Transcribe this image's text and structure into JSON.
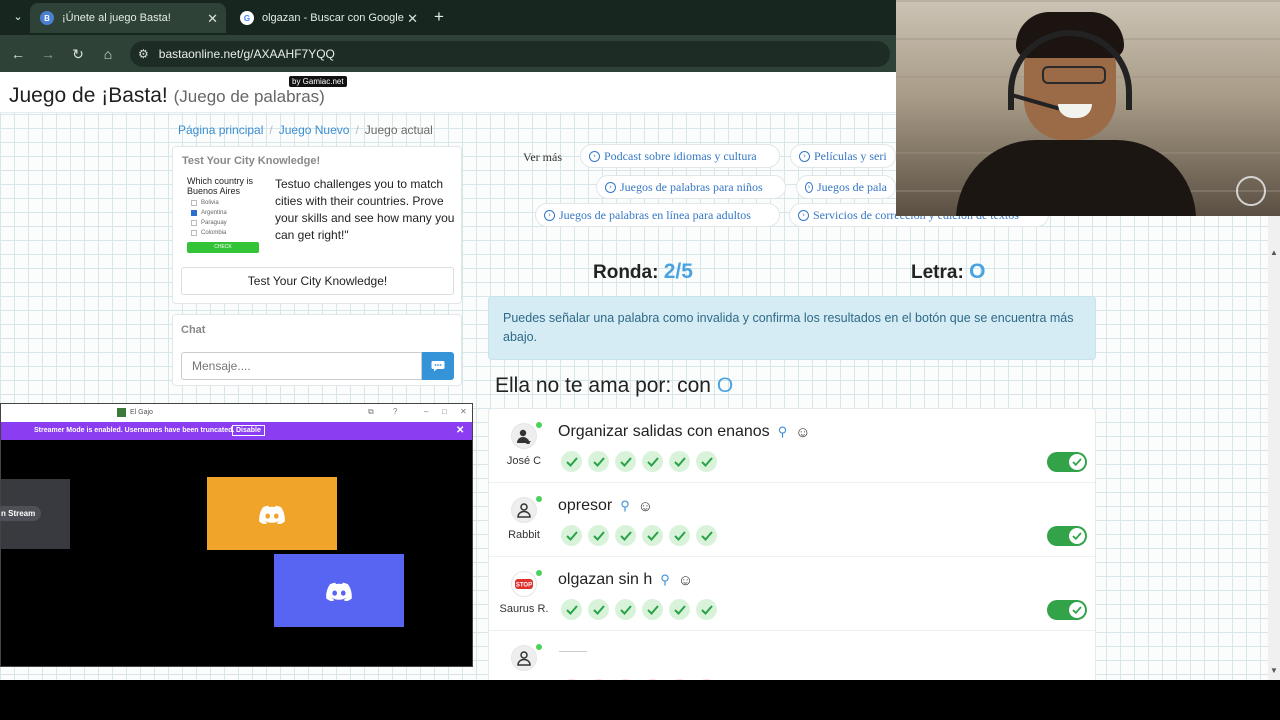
{
  "browser": {
    "tabs": [
      {
        "title": "¡Únete al juego Basta!",
        "active": true
      },
      {
        "title": "olgazan - Buscar con Google",
        "active": false
      }
    ],
    "url": "bastaonline.net/g/AXAAHF7YQQ"
  },
  "site": {
    "title": "Juego de ¡Basta!",
    "subtitle": "(Juego de palabras)",
    "badge": "by Gamiac.net"
  },
  "breadcrumb": {
    "home": "Página principal",
    "new_game": "Juego Nuevo",
    "current": "Juego actual"
  },
  "ad": {
    "heading": "Test Your City Knowledge!",
    "mini_question": "Which country is Buenos Aires",
    "mini_options": [
      "Bolivia",
      "Argentina",
      "Paraguay",
      "Colombia"
    ],
    "mini_checked": "Argentina",
    "mini_button": "CHECK",
    "text": "Testuo challenges you to match cities with their countries. Prove your skills and see how many you can get right!\"",
    "button": "Test Your City Knowledge!"
  },
  "chat": {
    "heading": "Chat",
    "placeholder": "Mensaje...."
  },
  "links": {
    "label": "Ver más",
    "items": [
      "Podcast sobre idiomas y cultura",
      "Películas y seri",
      "Juegos de palabras para niños",
      "Juegos de pala",
      "Juegos de palabras en línea para adultos",
      "Servicios de corrección y edición de textos"
    ]
  },
  "game": {
    "round_label": "Ronda:",
    "round_value": "2/5",
    "letter_label": "Letra:",
    "letter_value": "O",
    "info": "Puedes señalar una palabra como invalida y confirma los resultados en el botón que se encuentra más abajo.",
    "category_text": "Ella no te ama por: con",
    "category_letter": "O"
  },
  "answers": [
    {
      "user": "José C",
      "word": "Organizar salidas con enanos",
      "votes_ok": 6,
      "valid": true
    },
    {
      "user": "Rabbit",
      "word": "opresor",
      "votes_ok": 6,
      "valid": true
    },
    {
      "user": "Saurus R.",
      "word": "olgazan sin h",
      "votes_ok": 6,
      "valid": true
    },
    {
      "user": "",
      "word": "",
      "votes_ok": 0,
      "valid": false
    }
  ],
  "discord": {
    "window_title": "El Gajo",
    "banner": "Streamer Mode is enabled. Usernames have been truncated.",
    "banner_button": "Disable",
    "stream_label": "n Stream"
  },
  "colors": {
    "accent": "#49a3e0",
    "toggle_on": "#33a34a",
    "discord_orange": "#f0a52a",
    "discord_blurple": "#5865f2",
    "streamer_banner": "#8b3df2"
  }
}
